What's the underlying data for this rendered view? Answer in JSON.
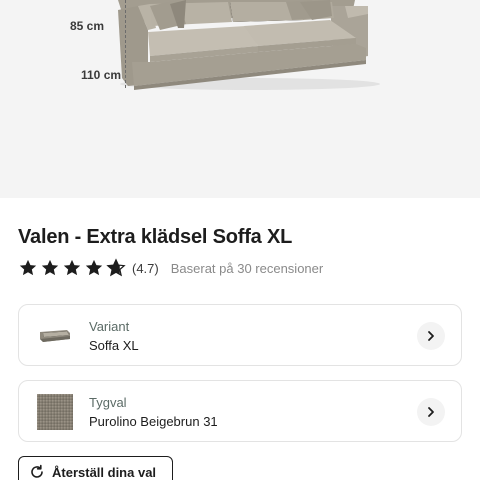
{
  "hero": {
    "dimension_height": "85 cm",
    "dimension_depth": "110 cm"
  },
  "product": {
    "title": "Valen - Extra klädsel Soffa XL",
    "rating_value": "(4.7)",
    "rating_stars": 4.7,
    "rating_count_text": "Baserat på 30 recensioner"
  },
  "options": {
    "variant": {
      "label": "Variant",
      "value": "Soffa XL",
      "icon": "sofa-thumbnail"
    },
    "fabric": {
      "label": "Tygval",
      "value": "Purolino Beigebrun 31",
      "icon": "fabric-swatch"
    }
  },
  "actions": {
    "reset_label": "Återställ dina val",
    "reset_icon": "refresh-icon"
  },
  "colors": {
    "hero_bg": "#f4f4f4",
    "sofa": "#aca699",
    "star": "#1d1d1d",
    "card_border": "#e3e3e3"
  }
}
